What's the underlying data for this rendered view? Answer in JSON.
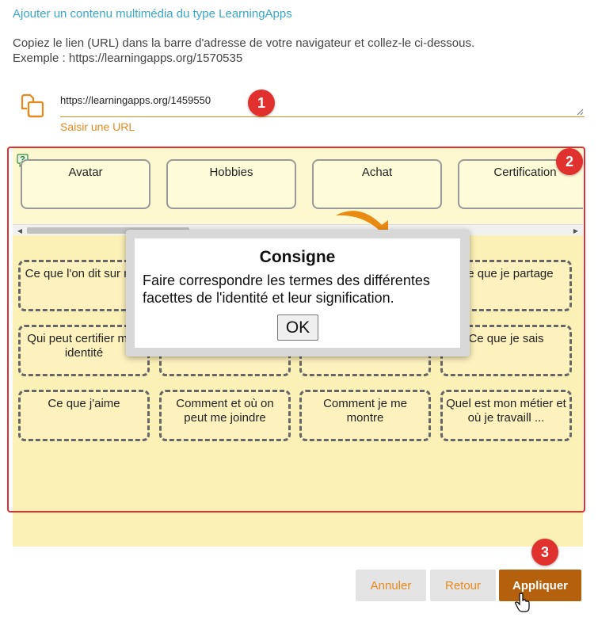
{
  "dialog": {
    "title": "Ajouter un contenu multimédia du type LearningApps",
    "instruction_line1": "Copiez le lien (URL) dans la barre d'adresse de votre navigateur et collez-le ci-dessous.",
    "instruction_line2": "Exemple : https://learningapps.org/1570535"
  },
  "url_input": {
    "value": "https://learningapps.org/1459550",
    "hint": "Saisir une URL",
    "icon": "copy-paste-icon"
  },
  "badges": [
    "1",
    "2",
    "3"
  ],
  "app": {
    "terms": [
      "Avatar",
      "Hobbies",
      "Achat",
      "Certification"
    ],
    "slots": [
      "Ce que l'on dit sur moi",
      "",
      "",
      "Ce que je partage",
      "Qui peut certifier mon identité",
      "",
      "",
      "Ce que je sais",
      "Ce que j'aime",
      "Comment et où on peut me joindre",
      "Comment je me montre",
      "Quel est mon métier et où je travaill ..."
    ]
  },
  "modal": {
    "title": "Consigne",
    "text": "Faire correspondre les termes des différentes facettes de l'identité et leur signification.",
    "ok_label": "OK"
  },
  "buttons": {
    "cancel": "Annuler",
    "back": "Retour",
    "apply": "Appliquer"
  },
  "colors": {
    "accent": "#e8891c",
    "title": "#3aa7c9",
    "badge": "#e0312f",
    "apply": "#b4600c"
  }
}
